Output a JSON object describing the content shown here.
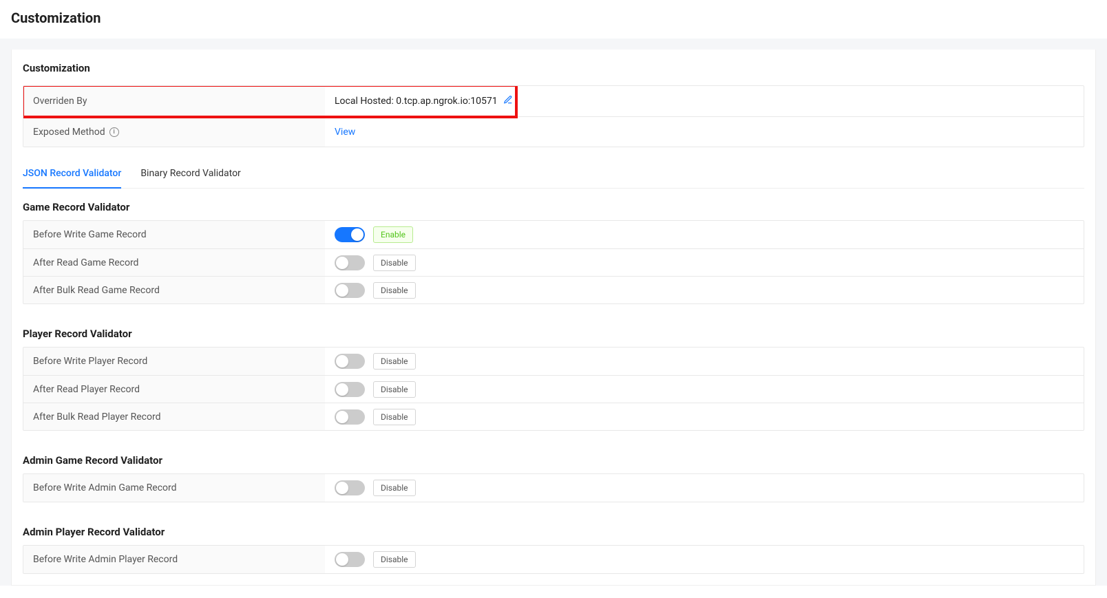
{
  "page_title": "Customization",
  "panel_title": "Customization",
  "info": {
    "overriden_by": {
      "label": "Overriden By",
      "value": "Local Hosted: 0.tcp.ap.ngrok.io:10571"
    },
    "exposed_method": {
      "label": "Exposed Method",
      "link": "View"
    }
  },
  "tabs": {
    "json": "JSON Record Validator",
    "binary": "Binary Record Validator"
  },
  "labels": {
    "enable": "Enable",
    "disable": "Disable"
  },
  "sections": [
    {
      "title": "Game Record Validator",
      "rows": [
        {
          "label": "Before Write Game Record",
          "enabled": true
        },
        {
          "label": "After Read Game Record",
          "enabled": false
        },
        {
          "label": "After Bulk Read Game Record",
          "enabled": false
        }
      ]
    },
    {
      "title": "Player Record Validator",
      "rows": [
        {
          "label": "Before Write Player Record",
          "enabled": false
        },
        {
          "label": "After Read Player Record",
          "enabled": false
        },
        {
          "label": "After Bulk Read Player Record",
          "enabled": false
        }
      ]
    },
    {
      "title": "Admin Game Record Validator",
      "rows": [
        {
          "label": "Before Write Admin Game Record",
          "enabled": false
        }
      ]
    },
    {
      "title": "Admin Player Record Validator",
      "rows": [
        {
          "label": "Before Write Admin Player Record",
          "enabled": false
        }
      ]
    }
  ]
}
